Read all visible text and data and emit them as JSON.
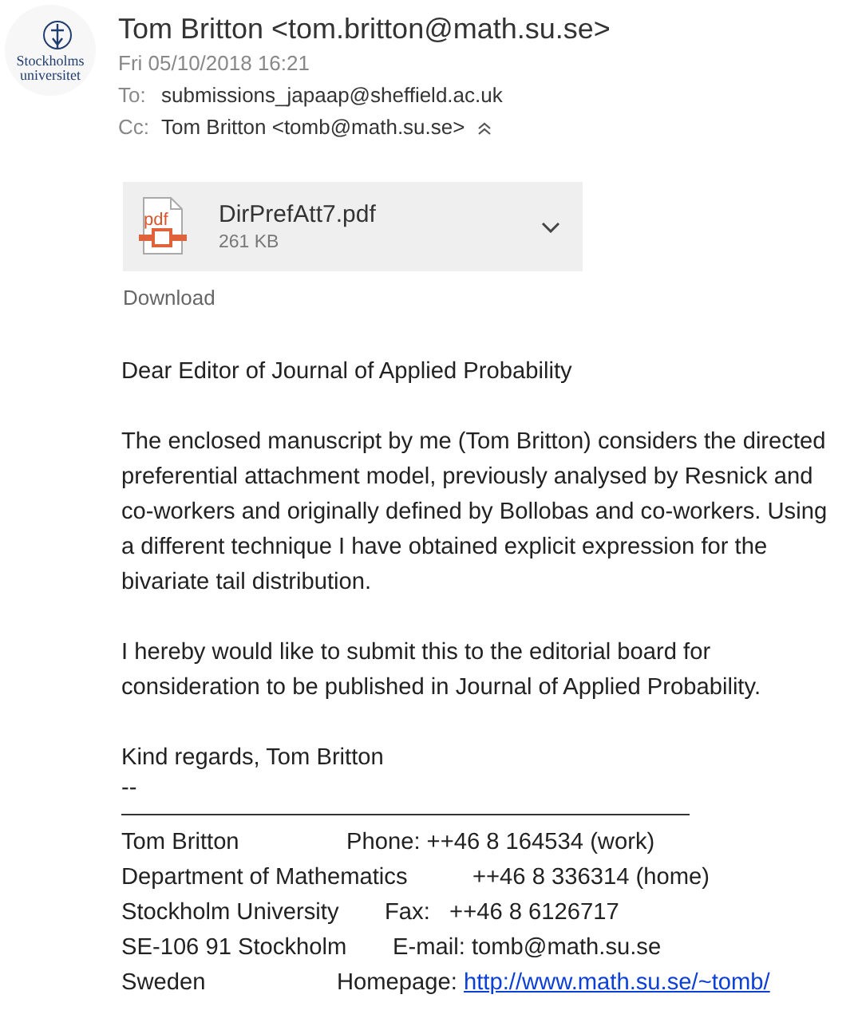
{
  "sender": {
    "logo_text": [
      "Stockholms",
      "universitet"
    ],
    "from": "Tom Britton <tom.britton@math.su.se>",
    "date": "Fri 05/10/2018 16:21",
    "to_label": "To:",
    "to": "submissions_japaap@sheffield.ac.uk",
    "cc_label": "Cc:",
    "cc": "Tom Britton <tomb@math.su.se>"
  },
  "attachment": {
    "name": "DirPrefAtt7.pdf",
    "size": "261 KB",
    "icon_text": "pdf",
    "download": "Download"
  },
  "body": {
    "paragraphs": [
      "Dear Editor of Journal of Applied Probability",
      "The enclosed manuscript by me (Tom Britton) considers the directed preferential attachment model, previously analysed by Resnick and co-workers and originally defined by Bollobas and co-workers. Using a different technique I have obtained explicit expression for the bivariate tail distribution.",
      "I hereby would like to submit this to the editorial board for consideration to be published in Journal of Applied Probability."
    ],
    "closing": "Kind regards, Tom Britton",
    "sig_dash": "--"
  },
  "signature": [
    {
      "left": "Tom Britton",
      "right": "Phone: ++46 8 164534 (work)"
    },
    {
      "left": "Department of Mathematics",
      "right": "++46 8 336314 (home)"
    },
    {
      "left": "Stockholm University",
      "right": "Fax:   ++46 8 6126717"
    },
    {
      "left": "SE-106 91 Stockholm",
      "right": "E-mail: tomb@math.su.se"
    },
    {
      "left": "Sweden",
      "right": "Homepage:",
      "link": "http://www.math.su.se/~tomb/"
    }
  ]
}
